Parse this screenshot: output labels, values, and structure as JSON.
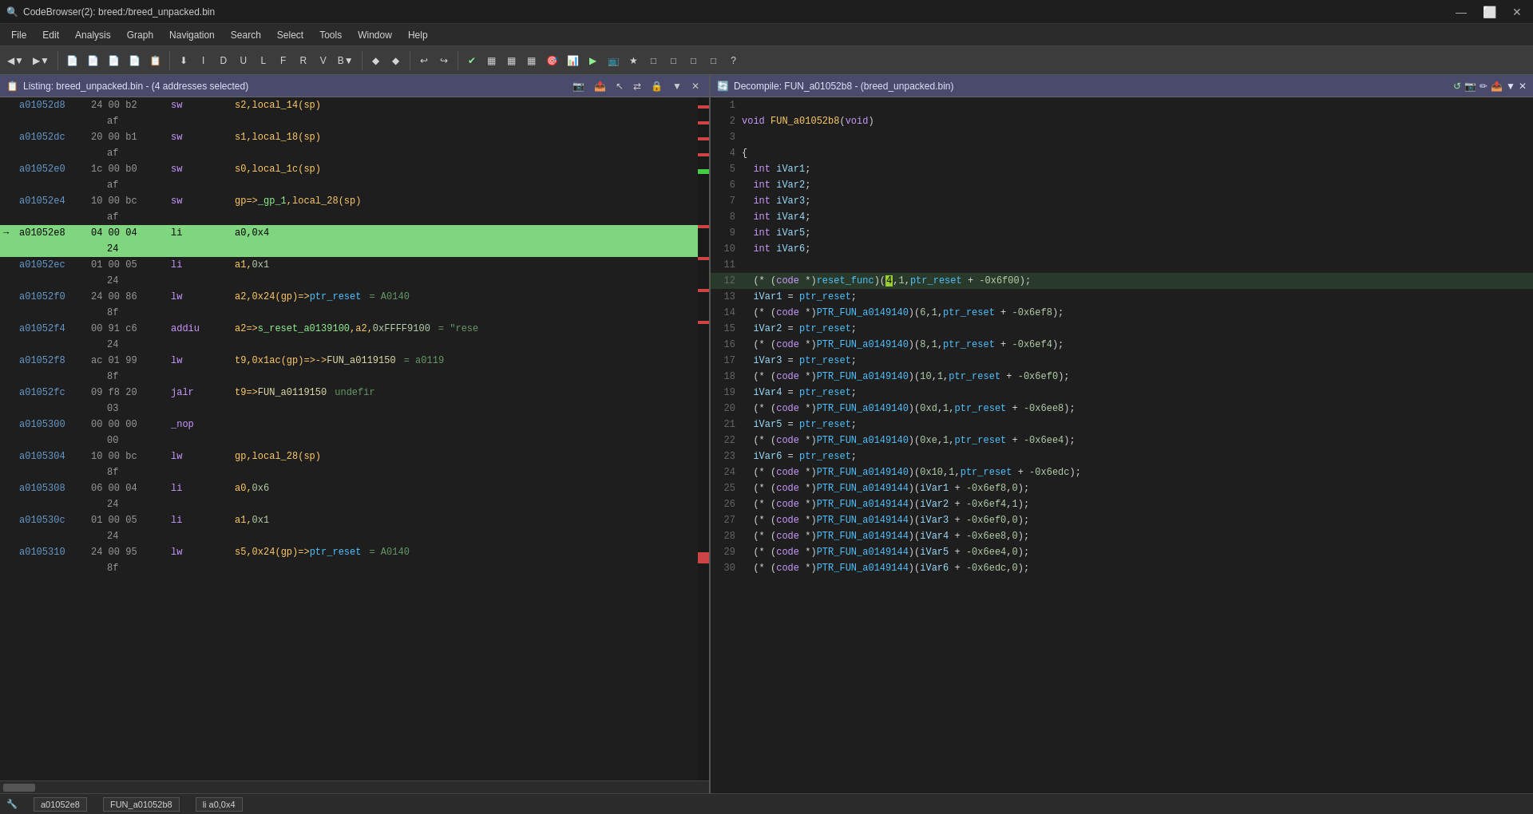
{
  "titlebar": {
    "title": "CodeBrowser(2): breed:/breed_unpacked.bin",
    "icon": "🔍",
    "controls": [
      "—",
      "⬜",
      "✕"
    ]
  },
  "menubar": {
    "items": [
      "File",
      "Edit",
      "Analysis",
      "Graph",
      "Navigation",
      "Search",
      "Select",
      "Tools",
      "Window",
      "Help"
    ]
  },
  "listing_panel": {
    "title": "Listing: breed_unpacked.bin - (4 addresses selected)"
  },
  "decompile_panel": {
    "title": "Decompile: FUN_a01052b8 - (breed_unpacked.bin)"
  },
  "listing_rows": [
    {
      "addr": "a01052d8",
      "bytes": "24 00 b2",
      "mnemonic": "sw",
      "operands": "s2,local_14(sp)",
      "indent": false,
      "highlight": false,
      "arrow": false
    },
    {
      "addr": "",
      "bytes": "af",
      "mnemonic": "",
      "operands": "",
      "indent": true,
      "highlight": false,
      "arrow": false
    },
    {
      "addr": "a01052dc",
      "bytes": "20 00 b1",
      "mnemonic": "sw",
      "operands": "s1,local_18(sp)",
      "indent": false,
      "highlight": false,
      "arrow": false
    },
    {
      "addr": "",
      "bytes": "af",
      "mnemonic": "",
      "operands": "",
      "indent": true,
      "highlight": false,
      "arrow": false
    },
    {
      "addr": "a01052e0",
      "bytes": "1c 00 b0",
      "mnemonic": "sw",
      "operands": "s0,local_1c(sp)",
      "indent": false,
      "highlight": false,
      "arrow": false
    },
    {
      "addr": "",
      "bytes": "af",
      "mnemonic": "",
      "operands": "",
      "indent": true,
      "highlight": false,
      "arrow": false
    },
    {
      "addr": "a01052e4",
      "bytes": "10 00 bc",
      "mnemonic": "sw",
      "operands": "gp=>_gp_1,local_28(sp)",
      "indent": false,
      "highlight": false,
      "arrow": false
    },
    {
      "addr": "",
      "bytes": "af",
      "mnemonic": "",
      "operands": "",
      "indent": true,
      "highlight": false,
      "arrow": false
    },
    {
      "addr": "a01052e8",
      "bytes": "04 00 04",
      "mnemonic": "li",
      "operands": "a0,0x4",
      "indent": false,
      "highlight": true,
      "arrow": true,
      "comment": ""
    },
    {
      "addr": "",
      "bytes": "24",
      "mnemonic": "",
      "operands": "",
      "indent": true,
      "highlight": true,
      "arrow": false
    },
    {
      "addr": "a01052ec",
      "bytes": "01 00 05",
      "mnemonic": "li",
      "operands": "a1,0x1",
      "indent": false,
      "highlight": false,
      "arrow": false
    },
    {
      "addr": "",
      "bytes": "24",
      "mnemonic": "",
      "operands": "",
      "indent": true,
      "highlight": false,
      "arrow": false
    },
    {
      "addr": "a01052f0",
      "bytes": "24 00 86",
      "mnemonic": "lw",
      "operands": "a2,0x24(gp)=>ptr_reset",
      "indent": false,
      "highlight": false,
      "arrow": false,
      "comment": "= A0140"
    },
    {
      "addr": "",
      "bytes": "8f",
      "mnemonic": "",
      "operands": "",
      "indent": true,
      "highlight": false,
      "arrow": false
    },
    {
      "addr": "a01052f4",
      "bytes": "00 91 c6",
      "mnemonic": "addiu",
      "operands": "a2=>s_reset_a0139100,a2,0xFFFF9100",
      "indent": false,
      "highlight": false,
      "arrow": false,
      "comment": "= \"rese"
    },
    {
      "addr": "",
      "bytes": "24",
      "mnemonic": "",
      "operands": "",
      "indent": true,
      "highlight": false,
      "arrow": false
    },
    {
      "addr": "a01052f8",
      "bytes": "ac 01 99",
      "mnemonic": "lw",
      "operands": "t9,0x1ac(gp)=>->FUN_a0119150",
      "indent": false,
      "highlight": false,
      "arrow": false,
      "comment": "= a0119"
    },
    {
      "addr": "",
      "bytes": "8f",
      "mnemonic": "",
      "operands": "",
      "indent": true,
      "highlight": false,
      "arrow": false
    },
    {
      "addr": "a01052fc",
      "bytes": "09 f8 20",
      "mnemonic": "jalr",
      "operands": "t9=>FUN_a0119150",
      "indent": false,
      "highlight": false,
      "arrow": false,
      "comment": "undefir"
    },
    {
      "addr": "",
      "bytes": "03",
      "mnemonic": "",
      "operands": "",
      "indent": true,
      "highlight": false,
      "arrow": false
    },
    {
      "addr": "a0105300",
      "bytes": "00 00 00",
      "mnemonic": "_nop",
      "operands": "",
      "indent": false,
      "highlight": false,
      "arrow": false
    },
    {
      "addr": "",
      "bytes": "00",
      "mnemonic": "",
      "operands": "",
      "indent": true,
      "highlight": false,
      "arrow": false
    },
    {
      "addr": "a0105304",
      "bytes": "10 00 bc",
      "mnemonic": "lw",
      "operands": "gp,local_28(sp)",
      "indent": false,
      "highlight": false,
      "arrow": false
    },
    {
      "addr": "",
      "bytes": "8f",
      "mnemonic": "",
      "operands": "",
      "indent": true,
      "highlight": false,
      "arrow": false
    },
    {
      "addr": "a0105308",
      "bytes": "06 00 04",
      "mnemonic": "li",
      "operands": "a0,0x6",
      "indent": false,
      "highlight": false,
      "arrow": false
    },
    {
      "addr": "",
      "bytes": "24",
      "mnemonic": "",
      "operands": "",
      "indent": true,
      "highlight": false,
      "arrow": false
    },
    {
      "addr": "a010530c",
      "bytes": "01 00 05",
      "mnemonic": "li",
      "operands": "a1,0x1",
      "indent": false,
      "highlight": false,
      "arrow": false
    },
    {
      "addr": "",
      "bytes": "24",
      "mnemonic": "",
      "operands": "",
      "indent": true,
      "highlight": false,
      "arrow": false
    },
    {
      "addr": "a0105310",
      "bytes": "24 00 95",
      "mnemonic": "lw",
      "operands": "s5,0x24(gp)=>ptr_reset",
      "indent": false,
      "highlight": false,
      "arrow": false,
      "comment": "= A0140"
    },
    {
      "addr": "",
      "bytes": "8f",
      "mnemonic": "",
      "operands": "",
      "indent": true,
      "highlight": false,
      "arrow": false
    }
  ],
  "decompile_rows": [
    {
      "line": 1,
      "code": "",
      "type": "empty"
    },
    {
      "line": 2,
      "code": "void FUN_a01052b8(void)",
      "type": "funcdef"
    },
    {
      "line": 3,
      "code": "",
      "type": "empty"
    },
    {
      "line": 4,
      "code": "{",
      "type": "brace"
    },
    {
      "line": 5,
      "code": "  int iVar1;",
      "type": "vardecl"
    },
    {
      "line": 6,
      "code": "  int iVar2;",
      "type": "vardecl"
    },
    {
      "line": 7,
      "code": "  int iVar3;",
      "type": "vardecl"
    },
    {
      "line": 8,
      "code": "  int iVar4;",
      "type": "vardecl"
    },
    {
      "line": 9,
      "code": "  int iVar5;",
      "type": "vardecl"
    },
    {
      "line": 10,
      "code": "  int iVar6;",
      "type": "vardecl"
    },
    {
      "line": 11,
      "code": "",
      "type": "empty"
    },
    {
      "line": 12,
      "code": "  (* (code *)reset_func)(4,1,ptr_reset + -0x6f00);",
      "type": "stmt",
      "highlighted": true
    },
    {
      "line": 13,
      "code": "  iVar1 = ptr_reset;",
      "type": "stmt"
    },
    {
      "line": 14,
      "code": "  (* (code *)PTR_FUN_a0149140)(6,1,ptr_reset + -0x6ef8);",
      "type": "stmt"
    },
    {
      "line": 15,
      "code": "  iVar2 = ptr_reset;",
      "type": "stmt"
    },
    {
      "line": 16,
      "code": "  (* (code *)PTR_FUN_a0149140)(8,1,ptr_reset + -0x6ef4);",
      "type": "stmt"
    },
    {
      "line": 17,
      "code": "  iVar3 = ptr_reset;",
      "type": "stmt"
    },
    {
      "line": 18,
      "code": "  (* (code *)PTR_FUN_a0149140)(10,1,ptr_reset + -0x6ef0);",
      "type": "stmt"
    },
    {
      "line": 19,
      "code": "  iVar4 = ptr_reset;",
      "type": "stmt"
    },
    {
      "line": 20,
      "code": "  (* (code *)PTR_FUN_a0149140)(0xd,1,ptr_reset + -0x6ee8);",
      "type": "stmt"
    },
    {
      "line": 21,
      "code": "  iVar5 = ptr_reset;",
      "type": "stmt"
    },
    {
      "line": 22,
      "code": "  (* (code *)PTR_FUN_a0149140)(0xe,1,ptr_reset + -0x6ee4);",
      "type": "stmt"
    },
    {
      "line": 23,
      "code": "  iVar6 = ptr_reset;",
      "type": "stmt"
    },
    {
      "line": 24,
      "code": "  (* (code *)PTR_FUN_a0149140)(0x10,1,ptr_reset + -0x6edc);",
      "type": "stmt"
    },
    {
      "line": 25,
      "code": "  (* (code *)PTR_FUN_a0149144)(iVar1 + -0x6ef8,0);",
      "type": "stmt"
    },
    {
      "line": 26,
      "code": "  (* (code *)PTR_FUN_a0149144)(iVar2 + -0x6ef4,1);",
      "type": "stmt"
    },
    {
      "line": 27,
      "code": "  (* (code *)PTR_FUN_a0149144)(iVar3 + -0x6ef0,0);",
      "type": "stmt"
    },
    {
      "line": 28,
      "code": "  (* (code *)PTR_FUN_a0149144)(iVar4 + -0x6ee8,0);",
      "type": "stmt"
    },
    {
      "line": 29,
      "code": "  (* (code *)PTR_FUN_a0149144)(iVar5 + -0x6ee4,0);",
      "type": "stmt"
    },
    {
      "line": 30,
      "code": "  (* (code *)PTR_FUN_a0149144)(iVar6 + -0x6edc,0);",
      "type": "stmt"
    }
  ],
  "statusbar": {
    "addr": "a01052e8",
    "func": "FUN_a01052b8",
    "status": "li a0,0x4"
  }
}
